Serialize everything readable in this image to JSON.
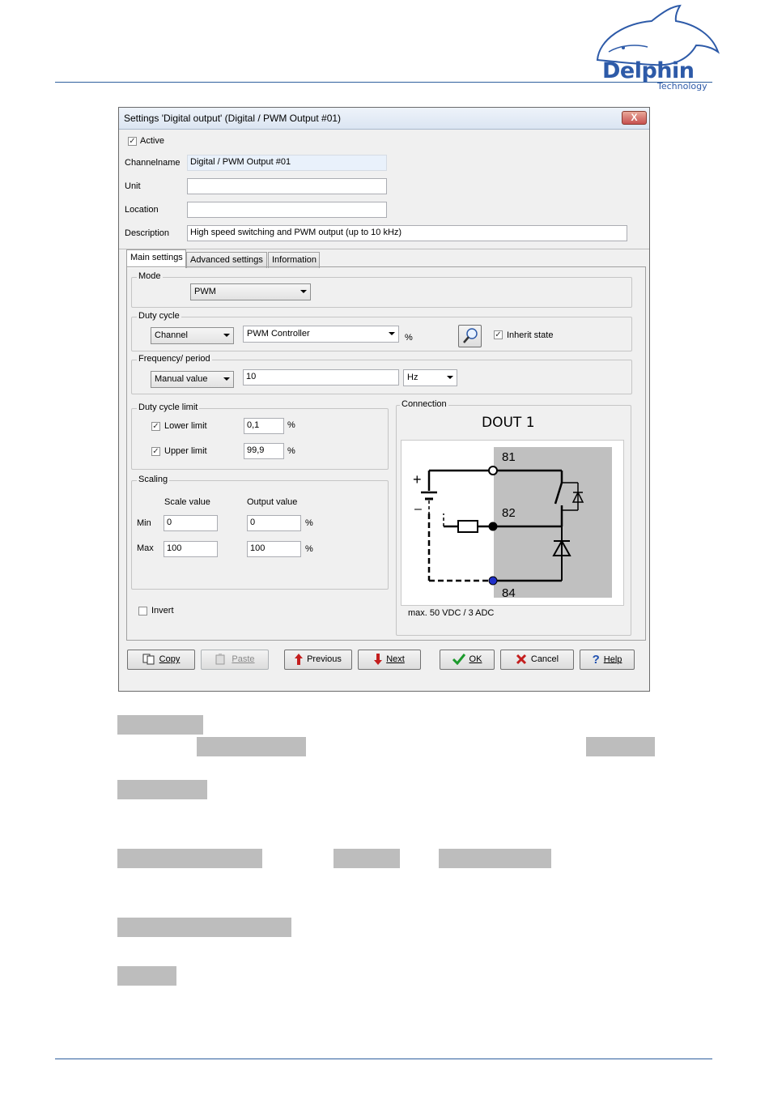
{
  "logo": {
    "name": "Delphin",
    "sub": "Technology"
  },
  "dialog": {
    "title": "Settings 'Digital output' (Digital / PWM Output #01)",
    "close": "X",
    "active_label": "Active",
    "active_checked": true,
    "fields": {
      "channelname_label": "Channelname",
      "channelname_value": "Digital / PWM Output #01",
      "unit_label": "Unit",
      "unit_value": "",
      "location_label": "Location",
      "location_value": "",
      "description_label": "Description",
      "description_value": "High speed switching and PWM output (up to 10 kHz)"
    },
    "tabs": [
      "Main settings",
      "Advanced settings",
      "Information"
    ],
    "mode": {
      "title": "Mode",
      "value": "PWM"
    },
    "duty_cycle": {
      "title": "Duty cycle",
      "source": "Channel",
      "channel": "PWM Controller",
      "unit": "%",
      "inherit_label": "Inherit state",
      "inherit_checked": true
    },
    "frequency": {
      "title": "Frequency/ period",
      "source": "Manual value",
      "value": "10",
      "unit": "Hz"
    },
    "duty_limit": {
      "title": "Duty cycle limit",
      "lower_label": "Lower limit",
      "lower_value": "0,1",
      "lower_checked": true,
      "upper_label": "Upper limit",
      "upper_value": "99,9",
      "upper_checked": true,
      "unit": "%"
    },
    "scaling": {
      "title": "Scaling",
      "scale_header": "Scale value",
      "output_header": "Output value",
      "min_label": "Min",
      "max_label": "Max",
      "min_scale": "0",
      "min_output": "0",
      "max_scale": "100",
      "max_output": "100",
      "unit": "%"
    },
    "invert_label": "Invert",
    "invert_checked": false,
    "connection": {
      "title": "Connection",
      "heading": "DOUT 1",
      "plus": "+",
      "minus": "–",
      "pin1": "81",
      "pin2": "82",
      "pin3": "84",
      "note": "max. 50 VDC / 3 ADC"
    },
    "buttons": {
      "copy": "Copy",
      "paste": "Paste",
      "previous": "Previous",
      "next": "Next",
      "ok": "OK",
      "cancel": "Cancel",
      "help": "Help"
    }
  }
}
